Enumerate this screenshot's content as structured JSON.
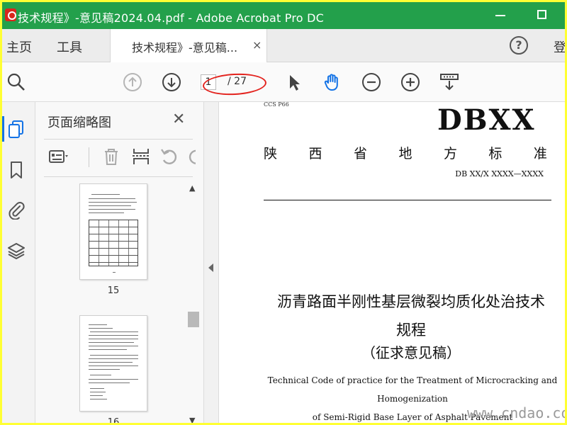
{
  "window": {
    "title": "技术规程》-意见稿2024.04.pdf - Adobe Acrobat Pro DC"
  },
  "menubar": {
    "home": "主页",
    "tools": "工具",
    "doc_tab": "技术规程》-意见稿...",
    "doc_tab_close": "×",
    "help": "?",
    "login": "登"
  },
  "toolbar": {
    "page_current": "1",
    "page_total": "/ 27",
    "icons": [
      "search-zoom-icon",
      "arrow-up-icon",
      "arrow-down-icon",
      "select-arrow-icon",
      "hand-icon",
      "zoom-out-icon",
      "zoom-in-icon",
      "scroll-mode-icon"
    ]
  },
  "thumbnails_panel": {
    "title": "页面缩略图",
    "close": "✕",
    "pages": [
      {
        "label": "15"
      },
      {
        "label": "16"
      }
    ]
  },
  "document": {
    "ccs": "CCS P66",
    "standard_code": "DBXX",
    "province_chars": [
      "陕",
      "西",
      "省",
      "地",
      "方",
      "标",
      "准"
    ],
    "db_number": "DB XX/X XXXX—XXXX",
    "title_line1": "沥青路面半刚性基层微裂均质化处治技术",
    "title_line2": "规程",
    "subtitle": "（征求意见稿）",
    "english_line1": "Technical Code of practice for the Treatment of Microcracking and Homogenization",
    "english_line2": "of Semi-Rigid Base Layer of Asphalt Pavement"
  },
  "watermark": "www.cndao.com",
  "colors": {
    "titlebar": "#23a04b",
    "frame_border": "#ffff33",
    "annotation_ellipse": "#e3231e",
    "accent": "#1473e6"
  }
}
